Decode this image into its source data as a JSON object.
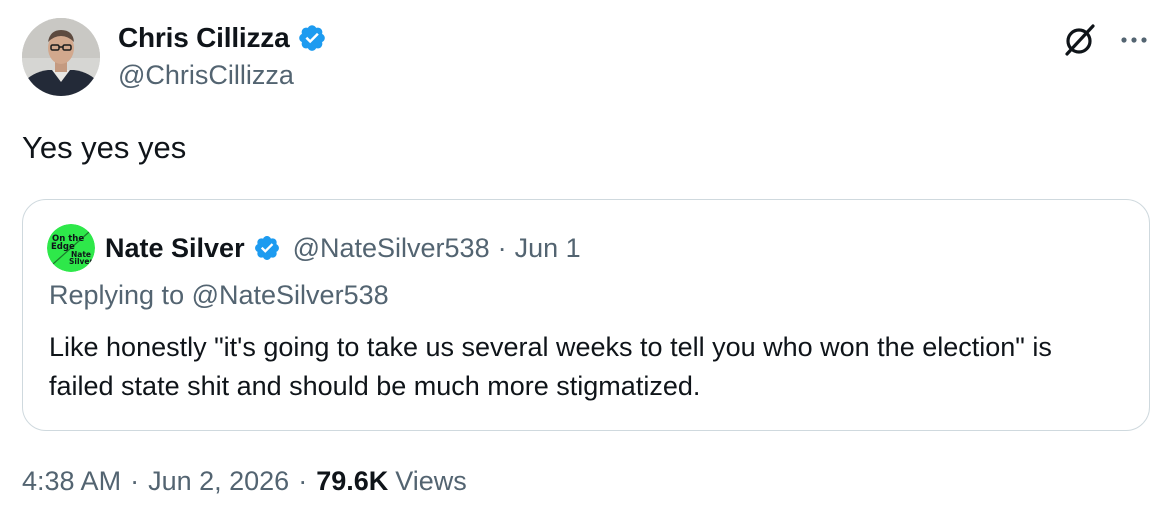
{
  "author": {
    "name": "Chris Cillizza",
    "handle": "@ChrisCillizza",
    "verified": true,
    "avatar_icon": "person-photo-icon"
  },
  "header_actions": {
    "grok_icon": "grok-icon",
    "more_icon": "more-icon"
  },
  "tweet": {
    "text": "Yes yes yes"
  },
  "quoted": {
    "name": "Nate Silver",
    "handle": "@NateSilver538",
    "separator": "·",
    "date": "Jun 1",
    "verified": true,
    "avatar_text": [
      "On the",
      "Edge",
      "Nate",
      "Silver"
    ],
    "replying_prefix": "Replying to",
    "replying_to": "@NateSilver538",
    "text": "Like honestly \"it's going to take us several weeks to tell you who won the election\" is failed state shit and should be much more stigmatized."
  },
  "meta": {
    "time": "4:38 AM",
    "separator": "·",
    "date": "Jun 2, 2026",
    "views_count": "79.6K",
    "views_label": "Views"
  },
  "colors": {
    "verified_blue": "#1d9bf0",
    "secondary_text": "#536471",
    "primary_text": "#0f1419",
    "border": "#cfd9de",
    "avatar_green": "#2ee84a"
  }
}
